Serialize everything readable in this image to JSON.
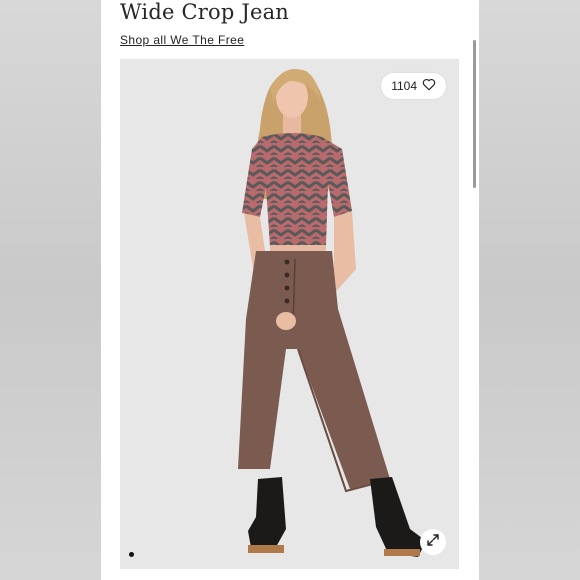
{
  "product": {
    "title": "Wide Crop Jean",
    "shop_link": "Shop all We The Free"
  },
  "image": {
    "like_count": "1104",
    "like_icon": "heart-icon",
    "expand_icon": "expand-icon",
    "carousel_dots": 1
  }
}
